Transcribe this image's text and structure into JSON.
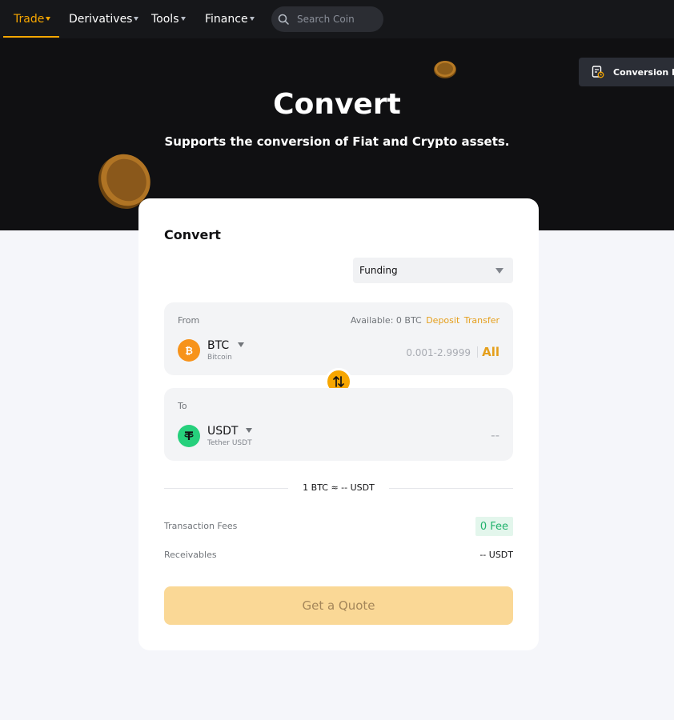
{
  "nav": {
    "items": [
      {
        "label": "Trade"
      },
      {
        "label": "Derivatives"
      },
      {
        "label": "Tools"
      },
      {
        "label": "Finance"
      }
    ],
    "search_placeholder": "Search Coin"
  },
  "hero": {
    "title": "Convert",
    "subtitle": "Supports the conversion of Fiat and Crypto assets.",
    "history_label": "Conversion History"
  },
  "card": {
    "title": "Convert",
    "account": "Funding",
    "from": {
      "label": "From",
      "available_prefix": "Available: 0 BTC",
      "deposit": "Deposit",
      "transfer": "Transfer",
      "symbol": "BTC",
      "name": "Bitcoin",
      "range": "0.001-2.9999",
      "all": "All"
    },
    "to": {
      "label": "To",
      "symbol": "USDT",
      "name": "Tether USDT",
      "amount": "--"
    },
    "rate": "1 BTC ≈ -- USDT",
    "fees_label": "Transaction Fees",
    "fees_value": "0 Fee",
    "receivables_label": "Receivables",
    "receivables_value": "-- USDT",
    "quote_button": "Get a Quote"
  },
  "colors": {
    "accent": "#f7a600",
    "btc": "#f7931a",
    "usdt": "#26d07c",
    "fee_green": "#20b26c"
  },
  "icons": [
    "search-icon",
    "conversion-history-icon",
    "btc-icon",
    "usdt-icon",
    "swap-icon"
  ]
}
